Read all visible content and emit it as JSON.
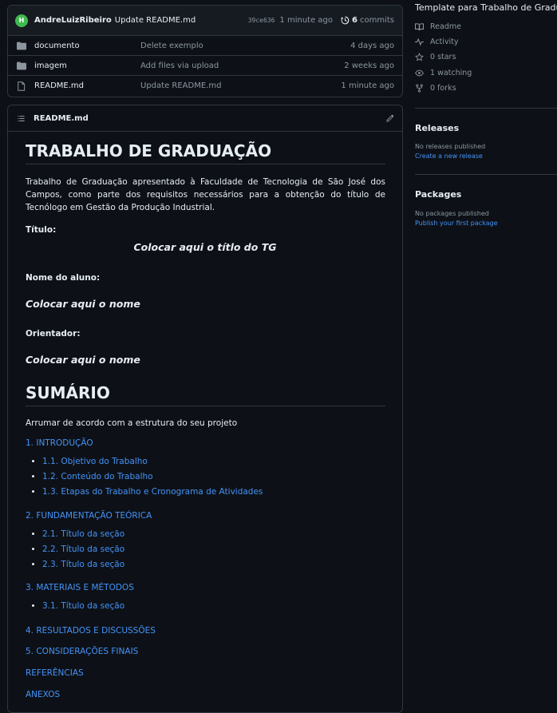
{
  "latest_commit": {
    "avatar_initial": "H",
    "author": "AndreLuizRibeiro",
    "message": "Update README.md",
    "hash": "39ce636",
    "time": "1 minute ago",
    "commit_count": "6",
    "commits_label": "commits"
  },
  "files": [
    {
      "name": "documento",
      "type": "folder",
      "message": "Delete exemplo",
      "age": "4 days ago"
    },
    {
      "name": "imagem",
      "type": "folder",
      "message": "Add files via upload",
      "age": "2 weeks ago"
    },
    {
      "name": "README.md",
      "type": "file",
      "message": "Update README.md",
      "age": "1 minute ago"
    }
  ],
  "readme": {
    "header": "README.md",
    "h1_title": "TRABALHO DE GRADUAÇÃO",
    "intro": "Trabalho de Graduação apresentado à Faculdade de Tecnologia de São José dos Campos, como parte dos requisitos necessários para a obtenção do título de Tecnólogo em Gestão da Produção Industrial.",
    "titulo_label": "Título:",
    "titulo_value": "Colocar aqui o títlo do TG",
    "aluno_label": "Nome do aluno:",
    "aluno_value": "Colocar aqui o nome",
    "orientador_label": "Orientador:",
    "orientador_value": "Colocar aqui o nome",
    "h1_sumario": "SUMÁRIO",
    "sumario_note": "Arrumar de acordo com a estrutura do seu projeto",
    "toc": [
      {
        "label": "1. INTRODUÇÃO",
        "items": [
          "1.1. Objetivo do Trabalho",
          "1.2. Conteúdo do Trabalho",
          "1.3. Etapas do Trabalho e Cronograma de Atividades"
        ]
      },
      {
        "label": "2. FUNDAMENTAÇÃO TEÓRICA",
        "items": [
          "2.1. Título da seção",
          "2.2. Título da seção",
          "2.3. Título da seção"
        ]
      },
      {
        "label": "3. MATERIAIS E MÉTODOS",
        "items": [
          "3.1. Título da seção"
        ]
      },
      {
        "label": "4. RESULTADOS E DISCUSSÕES",
        "items": []
      },
      {
        "label": "5. CONSIDERAÇÕES FINAIS",
        "items": []
      },
      {
        "label": "REFERÊNCIAS",
        "items": []
      },
      {
        "label": "ANEXOS",
        "items": []
      }
    ]
  },
  "sidebar": {
    "description": "Template para Trabalho de Graduação",
    "readme": "Readme",
    "activity": "Activity",
    "stars": "0 stars",
    "watching": "1 watching",
    "forks": "0 forks",
    "releases_title": "Releases",
    "releases_empty": "No releases published",
    "releases_link": "Create a new release",
    "packages_title": "Packages",
    "packages_empty": "No packages published",
    "packages_link": "Publish your first package"
  },
  "colors": {
    "background": "#0d1117",
    "link": "#4493f8",
    "muted": "#8d96a0",
    "border": "#30363d"
  }
}
